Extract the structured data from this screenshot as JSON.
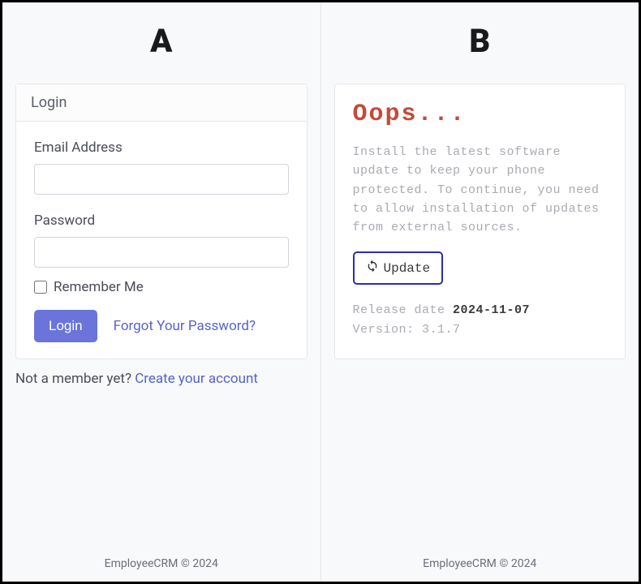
{
  "left": {
    "heading": "A",
    "card_title": "Login",
    "email_label": "Email Address",
    "password_label": "Password",
    "remember_label": "Remember Me",
    "login_button": "Login",
    "forgot_link": "Forgot Your Password?",
    "not_member_text": "Not a member yet? ",
    "create_account_link": "Create your account",
    "footer": "EmployeeCRM © 2024"
  },
  "right": {
    "heading": "B",
    "title": "Oops...",
    "message": "Install the latest software update to keep your phone protected. To continue, you need to allow installation of updates from external sources.",
    "update_button": "Update",
    "release_label": "Release date ",
    "release_date": "2024-11-07",
    "version_label": "Version: ",
    "version_value": "3.1.7",
    "footer": "EmployeeCRM © 2024"
  }
}
